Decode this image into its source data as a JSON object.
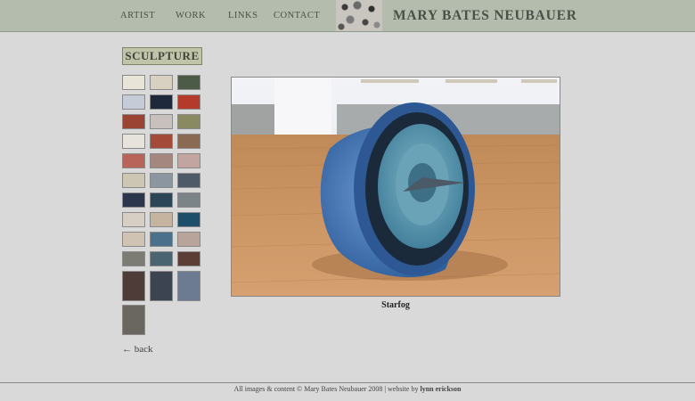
{
  "nav": [
    "ARTIST",
    "WORK",
    "LINKS",
    "CONTACT"
  ],
  "site_title": "MARY BATES NEUBAUER",
  "section_title": "SCULPTURE",
  "thumbnails": [
    {
      "bg": "#e8e4d8"
    },
    {
      "bg": "#d8d0c0"
    },
    {
      "bg": "#4c5a48"
    },
    {
      "bg": "#c6cbd8"
    },
    {
      "bg": "#1e2a3c"
    },
    {
      "bg": "#b43a2c"
    },
    {
      "bg": "#9a4434"
    },
    {
      "bg": "#c8c0bc"
    },
    {
      "bg": "#8a8a62"
    },
    {
      "bg": "#e6e2dc"
    },
    {
      "bg": "#a44a38"
    },
    {
      "bg": "#8a6a52"
    },
    {
      "bg": "#b8645a"
    },
    {
      "bg": "#a48880"
    },
    {
      "bg": "#c2a4a0"
    },
    {
      "bg": "#cdc6b2"
    },
    {
      "bg": "#8c96a0"
    },
    {
      "bg": "#4e5a68"
    },
    {
      "bg": "#2c364c"
    },
    {
      "bg": "#2c4658"
    },
    {
      "bg": "#7c8488"
    },
    {
      "bg": "#d8cfc4"
    },
    {
      "bg": "#c4b4a0"
    },
    {
      "bg": "#1e4f6a"
    },
    {
      "bg": "#cfc4b4"
    },
    {
      "bg": "#4a708c"
    },
    {
      "bg": "#b8a49a"
    },
    {
      "bg": "#7c7c74"
    },
    {
      "bg": "#4a6472"
    },
    {
      "bg": "#5c3e36"
    },
    {
      "bg": "#4e3c38"
    },
    {
      "bg": "#3c4452"
    },
    {
      "bg": "#6c7a92"
    },
    {
      "bg": "#6a6660"
    }
  ],
  "back_link": "← back",
  "main_image": {
    "title": "Starfog"
  },
  "footer": {
    "text": "All images & content © Mary Bates Neubauer 2008 | website by ",
    "credit": "lynn erickson"
  }
}
